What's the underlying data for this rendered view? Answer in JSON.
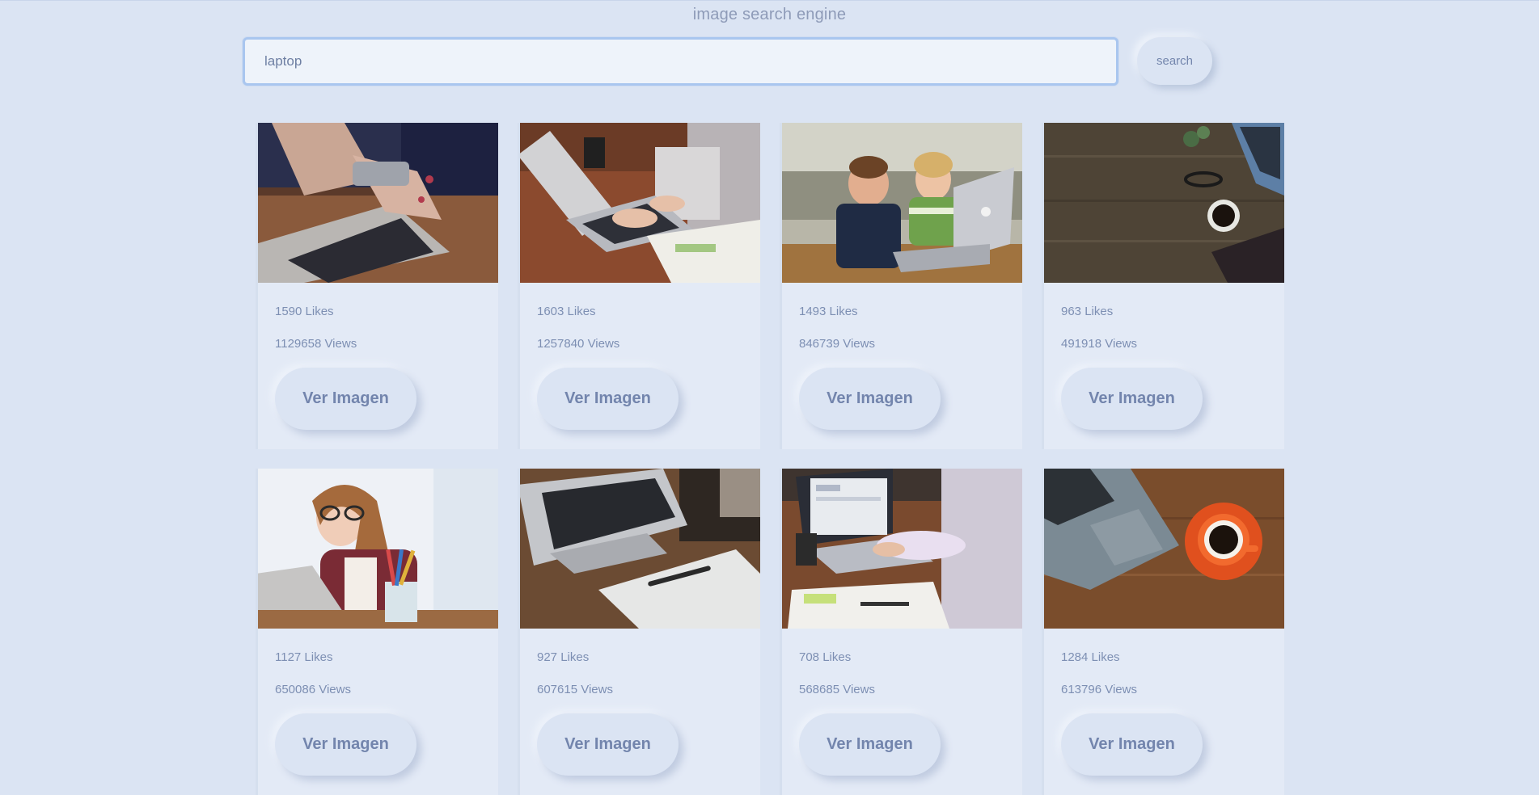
{
  "header": {
    "title": "image search engine"
  },
  "search": {
    "value": "laptop",
    "button_label": "search"
  },
  "results": [
    {
      "likes": "1590 Likes",
      "views": "1129658 Views",
      "button_label": "Ver Imagen",
      "image_subject": "hands with phone over laptop keyboard"
    },
    {
      "likes": "1603 Likes",
      "views": "1257840 Views",
      "button_label": "Ver Imagen",
      "image_subject": "person typing on laptop at wooden desk"
    },
    {
      "likes": "1493 Likes",
      "views": "846739 Views",
      "button_label": "Ver Imagen",
      "image_subject": "two excited kids with laptop"
    },
    {
      "likes": "963 Likes",
      "views": "491918 Views",
      "button_label": "Ver Imagen",
      "image_subject": "wooden desk with coffee, glasses and laptop"
    },
    {
      "likes": "1127 Likes",
      "views": "650086 Views",
      "button_label": "Ver Imagen",
      "image_subject": "woman with glasses thinking at laptop"
    },
    {
      "likes": "927 Likes",
      "views": "607615 Views",
      "button_label": "Ver Imagen",
      "image_subject": "laptop keyboard with tablet and pen"
    },
    {
      "likes": "708 Likes",
      "views": "568685 Views",
      "button_label": "Ver Imagen",
      "image_subject": "person working on laptop with papers"
    },
    {
      "likes": "1284 Likes",
      "views": "613796 Views",
      "button_label": "Ver Imagen",
      "image_subject": "laptop and orange coffee cup on wood"
    }
  ],
  "colors": {
    "background": "#dbe4f3",
    "card": "#e3eaf6",
    "text": "#7d8fb3",
    "input_border": "#a9c6ef"
  }
}
